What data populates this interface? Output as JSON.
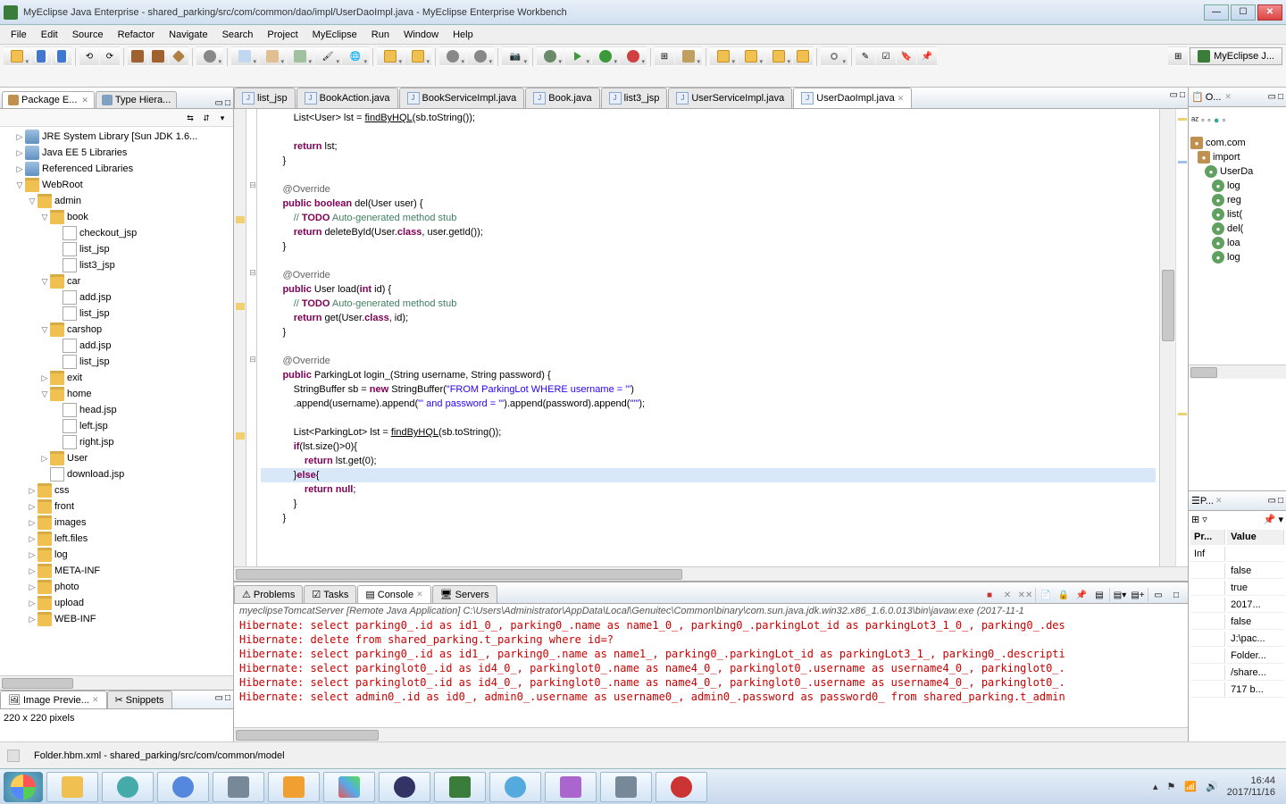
{
  "window": {
    "title": "MyEclipse Java Enterprise - shared_parking/src/com/common/dao/impl/UserDaoImpl.java - MyEclipse Enterprise Workbench"
  },
  "menu": [
    "File",
    "Edit",
    "Source",
    "Refactor",
    "Navigate",
    "Search",
    "Project",
    "MyEclipse",
    "Run",
    "Window",
    "Help"
  ],
  "perspective": "MyEclipse J...",
  "views": {
    "package_explorer": {
      "title": "Package E..."
    },
    "type_hierarchy": {
      "title": "Type Hiera..."
    },
    "image_preview": {
      "title": "Image Previe..."
    },
    "snippets": {
      "title": "Snippets"
    },
    "preview_info": "220 x 220 pixels"
  },
  "tree": [
    {
      "level": 1,
      "exp": "▷",
      "icon": "jar",
      "label": "JRE System Library [Sun JDK 1.6..."
    },
    {
      "level": 1,
      "exp": "▷",
      "icon": "jar",
      "label": "Java EE 5 Libraries"
    },
    {
      "level": 1,
      "exp": "▷",
      "icon": "jar",
      "label": "Referenced Libraries"
    },
    {
      "level": 1,
      "exp": "▽",
      "icon": "folder",
      "label": "WebRoot"
    },
    {
      "level": 2,
      "exp": "▽",
      "icon": "folder",
      "label": "admin"
    },
    {
      "level": 3,
      "exp": "▽",
      "icon": "folder",
      "label": "book"
    },
    {
      "level": 4,
      "exp": "",
      "icon": "file",
      "label": "checkout_jsp"
    },
    {
      "level": 4,
      "exp": "",
      "icon": "file",
      "label": "list_jsp"
    },
    {
      "level": 4,
      "exp": "",
      "icon": "file",
      "label": "list3_jsp"
    },
    {
      "level": 3,
      "exp": "▽",
      "icon": "folder",
      "label": "car"
    },
    {
      "level": 4,
      "exp": "",
      "icon": "file",
      "label": "add.jsp"
    },
    {
      "level": 4,
      "exp": "",
      "icon": "file",
      "label": "list_jsp"
    },
    {
      "level": 3,
      "exp": "▽",
      "icon": "folder",
      "label": "carshop"
    },
    {
      "level": 4,
      "exp": "",
      "icon": "file",
      "label": "add.jsp"
    },
    {
      "level": 4,
      "exp": "",
      "icon": "file",
      "label": "list_jsp"
    },
    {
      "level": 3,
      "exp": "▷",
      "icon": "folder",
      "label": "exit"
    },
    {
      "level": 3,
      "exp": "▽",
      "icon": "folder",
      "label": "home"
    },
    {
      "level": 4,
      "exp": "",
      "icon": "file",
      "label": "head.jsp"
    },
    {
      "level": 4,
      "exp": "",
      "icon": "file",
      "label": "left.jsp"
    },
    {
      "level": 4,
      "exp": "",
      "icon": "file",
      "label": "right.jsp"
    },
    {
      "level": 3,
      "exp": "▷",
      "icon": "folder",
      "label": "User"
    },
    {
      "level": 3,
      "exp": "",
      "icon": "file",
      "label": "download.jsp"
    },
    {
      "level": 2,
      "exp": "▷",
      "icon": "folder",
      "label": "css"
    },
    {
      "level": 2,
      "exp": "▷",
      "icon": "folder",
      "label": "front"
    },
    {
      "level": 2,
      "exp": "▷",
      "icon": "folder",
      "label": "images"
    },
    {
      "level": 2,
      "exp": "▷",
      "icon": "folder",
      "label": "left.files"
    },
    {
      "level": 2,
      "exp": "▷",
      "icon": "folder",
      "label": "log"
    },
    {
      "level": 2,
      "exp": "▷",
      "icon": "folder",
      "label": "META-INF"
    },
    {
      "level": 2,
      "exp": "▷",
      "icon": "folder",
      "label": "photo"
    },
    {
      "level": 2,
      "exp": "▷",
      "icon": "folder",
      "label": "upload"
    },
    {
      "level": 2,
      "exp": "▷",
      "icon": "folder",
      "label": "WEB-INF"
    }
  ],
  "editor_tabs": [
    {
      "label": "list_jsp",
      "kind": "J"
    },
    {
      "label": "BookAction.java",
      "kind": "J"
    },
    {
      "label": "BookServiceImpl.java",
      "kind": "J"
    },
    {
      "label": "Book.java",
      "kind": "J"
    },
    {
      "label": "list3_jsp",
      "kind": "J"
    },
    {
      "label": "UserServiceImpl.java",
      "kind": "J"
    },
    {
      "label": "UserDaoImpl.java",
      "kind": "J",
      "active": true
    }
  ],
  "code_lines": [
    {
      "t": "            List<User> lst = findByHQL(sb.toString());",
      "fmt": [
        [
          "plain",
          "            List<User> lst = "
        ],
        [
          "under",
          "findByHQL"
        ],
        [
          "plain",
          "(sb.toString());"
        ]
      ]
    },
    {
      "t": ""
    },
    {
      "t": "            return lst;",
      "fmt": [
        [
          "plain",
          "            "
        ],
        [
          "kw",
          "return"
        ],
        [
          "plain",
          " lst;"
        ]
      ]
    },
    {
      "t": "        }"
    },
    {
      "t": ""
    },
    {
      "t": "        @Override",
      "fmt": [
        [
          "plain",
          "        "
        ],
        [
          "ann",
          "@Override"
        ]
      ]
    },
    {
      "t": "        public boolean del(User user) {",
      "fmt": [
        [
          "plain",
          "        "
        ],
        [
          "kw",
          "public"
        ],
        [
          "plain",
          " "
        ],
        [
          "kw",
          "boolean"
        ],
        [
          "plain",
          " del(User user) {"
        ]
      ]
    },
    {
      "t": "            // TODO Auto-generated method stub",
      "fmt": [
        [
          "plain",
          "            "
        ],
        [
          "cm",
          "// "
        ],
        [
          "kw",
          "TODO"
        ],
        [
          "cm",
          " Auto-generated method stub"
        ]
      ]
    },
    {
      "t": "            return deleteById(User.class, user.getId());",
      "fmt": [
        [
          "plain",
          "            "
        ],
        [
          "kw",
          "return"
        ],
        [
          "plain",
          " deleteById(User."
        ],
        [
          "kw",
          "class"
        ],
        [
          "plain",
          ", user.getId());"
        ]
      ]
    },
    {
      "t": "        }"
    },
    {
      "t": ""
    },
    {
      "t": "        @Override",
      "fmt": [
        [
          "plain",
          "        "
        ],
        [
          "ann",
          "@Override"
        ]
      ]
    },
    {
      "t": "        public User load(int id) {",
      "fmt": [
        [
          "plain",
          "        "
        ],
        [
          "kw",
          "public"
        ],
        [
          "plain",
          " User load("
        ],
        [
          "kw",
          "int"
        ],
        [
          "plain",
          " id) {"
        ]
      ]
    },
    {
      "t": "            // TODO Auto-generated method stub",
      "fmt": [
        [
          "plain",
          "            "
        ],
        [
          "cm",
          "// "
        ],
        [
          "kw",
          "TODO"
        ],
        [
          "cm",
          " Auto-generated method stub"
        ]
      ]
    },
    {
      "t": "            return get(User.class, id);",
      "fmt": [
        [
          "plain",
          "            "
        ],
        [
          "kw",
          "return"
        ],
        [
          "plain",
          " get(User."
        ],
        [
          "kw",
          "class"
        ],
        [
          "plain",
          ", id);"
        ]
      ]
    },
    {
      "t": "        }"
    },
    {
      "t": ""
    },
    {
      "t": "        @Override",
      "fmt": [
        [
          "plain",
          "        "
        ],
        [
          "ann",
          "@Override"
        ]
      ]
    },
    {
      "t": "        public ParkingLot login_(String username, String password) {",
      "fmt": [
        [
          "plain",
          "        "
        ],
        [
          "kw",
          "public"
        ],
        [
          "plain",
          " ParkingLot login_(String username, String password) {"
        ]
      ]
    },
    {
      "t": "            StringBuffer sb = new StringBuffer(\"FROM ParkingLot WHERE username = '\")",
      "fmt": [
        [
          "plain",
          "            StringBuffer sb = "
        ],
        [
          "kw",
          "new"
        ],
        [
          "plain",
          " StringBuffer("
        ],
        [
          "str",
          "\"FROM ParkingLot WHERE username = '\""
        ],
        [
          "plain",
          ")"
        ]
      ]
    },
    {
      "t": "            .append(username).append(\"' and password = '\").append(password).append(\"'\");",
      "fmt": [
        [
          "plain",
          "            .append(username).append("
        ],
        [
          "str",
          "\"' and password = '\""
        ],
        [
          "plain",
          ").append(password).append("
        ],
        [
          "str",
          "\"'\""
        ],
        [
          "plain",
          ");"
        ]
      ]
    },
    {
      "t": ""
    },
    {
      "t": "            List<ParkingLot> lst = findByHQL(sb.toString());",
      "fmt": [
        [
          "plain",
          "            List<ParkingLot> lst = "
        ],
        [
          "under",
          "findByHQL"
        ],
        [
          "plain",
          "(sb.toString());"
        ]
      ]
    },
    {
      "t": "            if(lst.size()>0){",
      "fmt": [
        [
          "plain",
          "            "
        ],
        [
          "kw",
          "if"
        ],
        [
          "plain",
          "(lst.size()>0){"
        ]
      ]
    },
    {
      "t": "                return lst.get(0);",
      "fmt": [
        [
          "plain",
          "                "
        ],
        [
          "kw",
          "return"
        ],
        [
          "plain",
          " lst.get(0);"
        ]
      ]
    },
    {
      "t": "            }else{",
      "fmt": [
        [
          "plain",
          "            }"
        ],
        [
          "kw",
          "else"
        ],
        [
          "plain",
          "{"
        ]
      ],
      "hl": true
    },
    {
      "t": "                return null;",
      "fmt": [
        [
          "plain",
          "                "
        ],
        [
          "kw",
          "return"
        ],
        [
          "plain",
          " "
        ],
        [
          "kw",
          "null"
        ],
        [
          "plain",
          ";"
        ]
      ]
    },
    {
      "t": "            }"
    },
    {
      "t": "        }"
    }
  ],
  "console": {
    "tabs": {
      "problems": "Problems",
      "tasks": "Tasks",
      "console": "Console",
      "servers": "Servers"
    },
    "header": "myeclipseTomcatServer [Remote Java Application] C:\\Users\\Administrator\\AppData\\Local\\Genuitec\\Common\\binary\\com.sun.java.jdk.win32.x86_1.6.0.013\\bin\\javaw.exe (2017-11-1",
    "lines": [
      "Hibernate: select parking0_.id as id1_0_, parking0_.name as name1_0_, parking0_.parkingLot_id as parkingLot3_1_0_, parking0_.des",
      "Hibernate: delete from shared_parking.t_parking where id=?",
      "Hibernate: select parking0_.id as id1_, parking0_.name as name1_, parking0_.parkingLot_id as parkingLot3_1_, parking0_.descripti",
      "Hibernate: select parkinglot0_.id as id4_0_, parkinglot0_.name as name4_0_, parkinglot0_.username as username4_0_, parkinglot0_.",
      "Hibernate: select parkinglot0_.id as id4_0_, parkinglot0_.name as name4_0_, parkinglot0_.username as username4_0_, parkinglot0_.",
      "Hibernate: select admin0_.id as id0_, admin0_.username as username0_, admin0_.password as password0_ from shared_parking.t_admin"
    ]
  },
  "outline": {
    "tab": "O...",
    "items": [
      {
        "sym": "pkg",
        "label": "com.com"
      },
      {
        "sym": "pkg",
        "label": "import "
      },
      {
        "sym": "cls",
        "label": "UserDa"
      },
      {
        "sym": "method",
        "label": "log"
      },
      {
        "sym": "method",
        "label": "reg"
      },
      {
        "sym": "method",
        "label": "list("
      },
      {
        "sym": "method",
        "label": "del("
      },
      {
        "sym": "method",
        "label": "loa"
      },
      {
        "sym": "method",
        "label": "log"
      }
    ]
  },
  "properties": {
    "tab": "P...",
    "headers": {
      "name": "Pr...",
      "value": "Value"
    },
    "rows": [
      {
        "name": "Inf",
        "value": ""
      },
      {
        "name": "",
        "value": "false"
      },
      {
        "name": "",
        "value": "true"
      },
      {
        "name": "",
        "value": "2017..."
      },
      {
        "name": "",
        "value": "false"
      },
      {
        "name": "",
        "value": "J:\\pac..."
      },
      {
        "name": "",
        "value": "Folder..."
      },
      {
        "name": "",
        "value": "/share..."
      },
      {
        "name": "",
        "value": "717  b..."
      }
    ]
  },
  "statusbar": {
    "text": "Folder.hbm.xml - shared_parking/src/com/common/model"
  },
  "taskbar": {
    "clock_time": "16:44",
    "clock_date": "2017/11/16"
  }
}
